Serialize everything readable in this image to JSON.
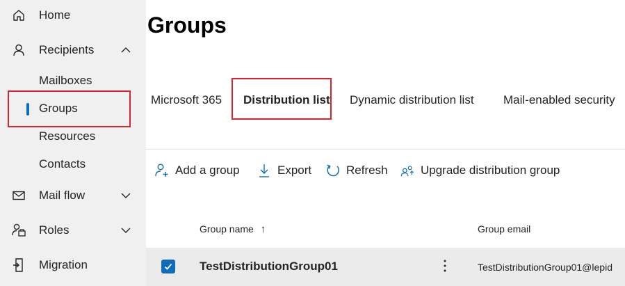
{
  "sidebar": {
    "home": {
      "label": "Home",
      "icon": "home-icon"
    },
    "recipients": {
      "label": "Recipients",
      "icon": "person-icon",
      "expanded": true
    },
    "sub_items": [
      {
        "label": "Mailboxes"
      },
      {
        "label": "Groups",
        "active": true
      },
      {
        "label": "Resources"
      },
      {
        "label": "Contacts"
      }
    ],
    "mail_flow": {
      "label": "Mail flow",
      "icon": "mail-icon"
    },
    "roles": {
      "label": "Roles",
      "icon": "roles-icon"
    },
    "migration": {
      "label": "Migration",
      "icon": "migration-icon"
    }
  },
  "main": {
    "title": "Groups",
    "tabs": [
      {
        "label": "Microsoft 365"
      },
      {
        "label": "Distribution list",
        "active": true
      },
      {
        "label": "Dynamic distribution list"
      },
      {
        "label": "Mail-enabled security"
      }
    ],
    "commands": [
      {
        "label": "Add a group",
        "icon": "add-person-icon"
      },
      {
        "label": "Export",
        "icon": "download-icon"
      },
      {
        "label": "Refresh",
        "icon": "refresh-icon"
      },
      {
        "label": "Upgrade distribution group",
        "icon": "people-upgrade-icon"
      }
    ],
    "columns": {
      "name": "Group name",
      "name_sort": "↑",
      "email": "Group email"
    },
    "rows": [
      {
        "name": "TestDistributionGroup01",
        "email": "TestDistributionGroup01@lepid",
        "selected": true
      }
    ]
  },
  "colors": {
    "accent": "#0f6cbd",
    "highlight": "#d9232f",
    "sidebar_bg": "#f0f0f0",
    "row_bg": "#ebebeb"
  }
}
